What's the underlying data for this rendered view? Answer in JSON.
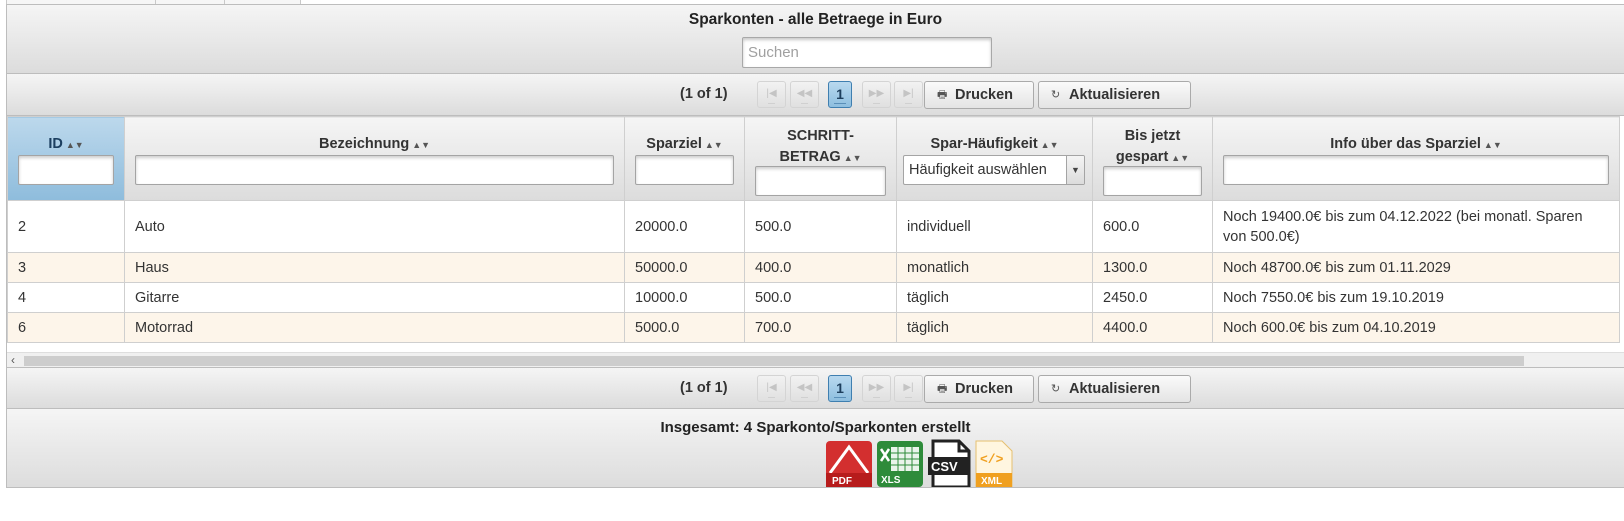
{
  "panel": {
    "title": "Sparkonten - alle Betraege in Euro",
    "search_placeholder": "Suchen"
  },
  "paginator": {
    "count": "(1 of 1)",
    "current_page": "1",
    "first_icon": "first-page-icon",
    "prev_icon": "prev-page-icon",
    "next_icon": "next-page-icon",
    "last_icon": "last-page-icon",
    "print_label": "Drucken",
    "print_icon": "printer-icon",
    "refresh_label": "Aktualisieren",
    "refresh_icon": "refresh-icon"
  },
  "columns": [
    {
      "key": "id",
      "label": "ID"
    },
    {
      "key": "bezeichnung",
      "label": "Bezeichnung"
    },
    {
      "key": "sparziel",
      "label": "Sparziel"
    },
    {
      "key": "schrittbetrag",
      "label_line1": "SCHRITT-",
      "label_line2": "BETRAG"
    },
    {
      "key": "haeufigkeit",
      "label": "Spar-Häufigkeit",
      "filter_placeholder": "Häufigkeit auswählen"
    },
    {
      "key": "gespart",
      "label_line1": "Bis jetzt",
      "label_line2": "gespart"
    },
    {
      "key": "info",
      "label": "Info über das Sparziel"
    }
  ],
  "rows": [
    {
      "id": "2",
      "bezeichnung": "Auto",
      "sparziel": "20000.0",
      "schrittbetrag": "500.0",
      "haeufigkeit": "individuell",
      "gespart": "600.0",
      "info": "Noch 19400.0€ bis zum 04.12.2022 (bei monatl. Sparen von 500.0€)"
    },
    {
      "id": "3",
      "bezeichnung": "Haus",
      "sparziel": "50000.0",
      "schrittbetrag": "400.0",
      "haeufigkeit": "monatlich",
      "gespart": "1300.0",
      "info": "Noch 48700.0€ bis zum 01.11.2029"
    },
    {
      "id": "4",
      "bezeichnung": "Gitarre",
      "sparziel": "10000.0",
      "schrittbetrag": "500.0",
      "haeufigkeit": "täglich",
      "gespart": "2450.0",
      "info": "Noch 7550.0€ bis zum 19.10.2019"
    },
    {
      "id": "6",
      "bezeichnung": "Motorrad",
      "sparziel": "5000.0",
      "schrittbetrag": "700.0",
      "haeufigkeit": "täglich",
      "gespart": "4400.0",
      "info": "Noch 600.0€ bis zum 04.10.2019"
    }
  ],
  "footer": {
    "total": "Insgesamt: 4 Sparkonto/Sparkonten erstellt",
    "exports": [
      {
        "name": "pdf-export-icon",
        "label": "PDF",
        "color": "#d32f2f"
      },
      {
        "name": "xls-export-icon",
        "label": "XLS",
        "color": "#2e8b3a"
      },
      {
        "name": "csv-export-icon",
        "label": "CSV",
        "color": "#222222"
      },
      {
        "name": "xml-export-icon",
        "label": "XML",
        "color": "#f0a020"
      }
    ]
  },
  "colors": {
    "sorted_header": "#9cc6e2",
    "alt_row": "#fdf5ea",
    "page_active": "#8dbedf"
  }
}
